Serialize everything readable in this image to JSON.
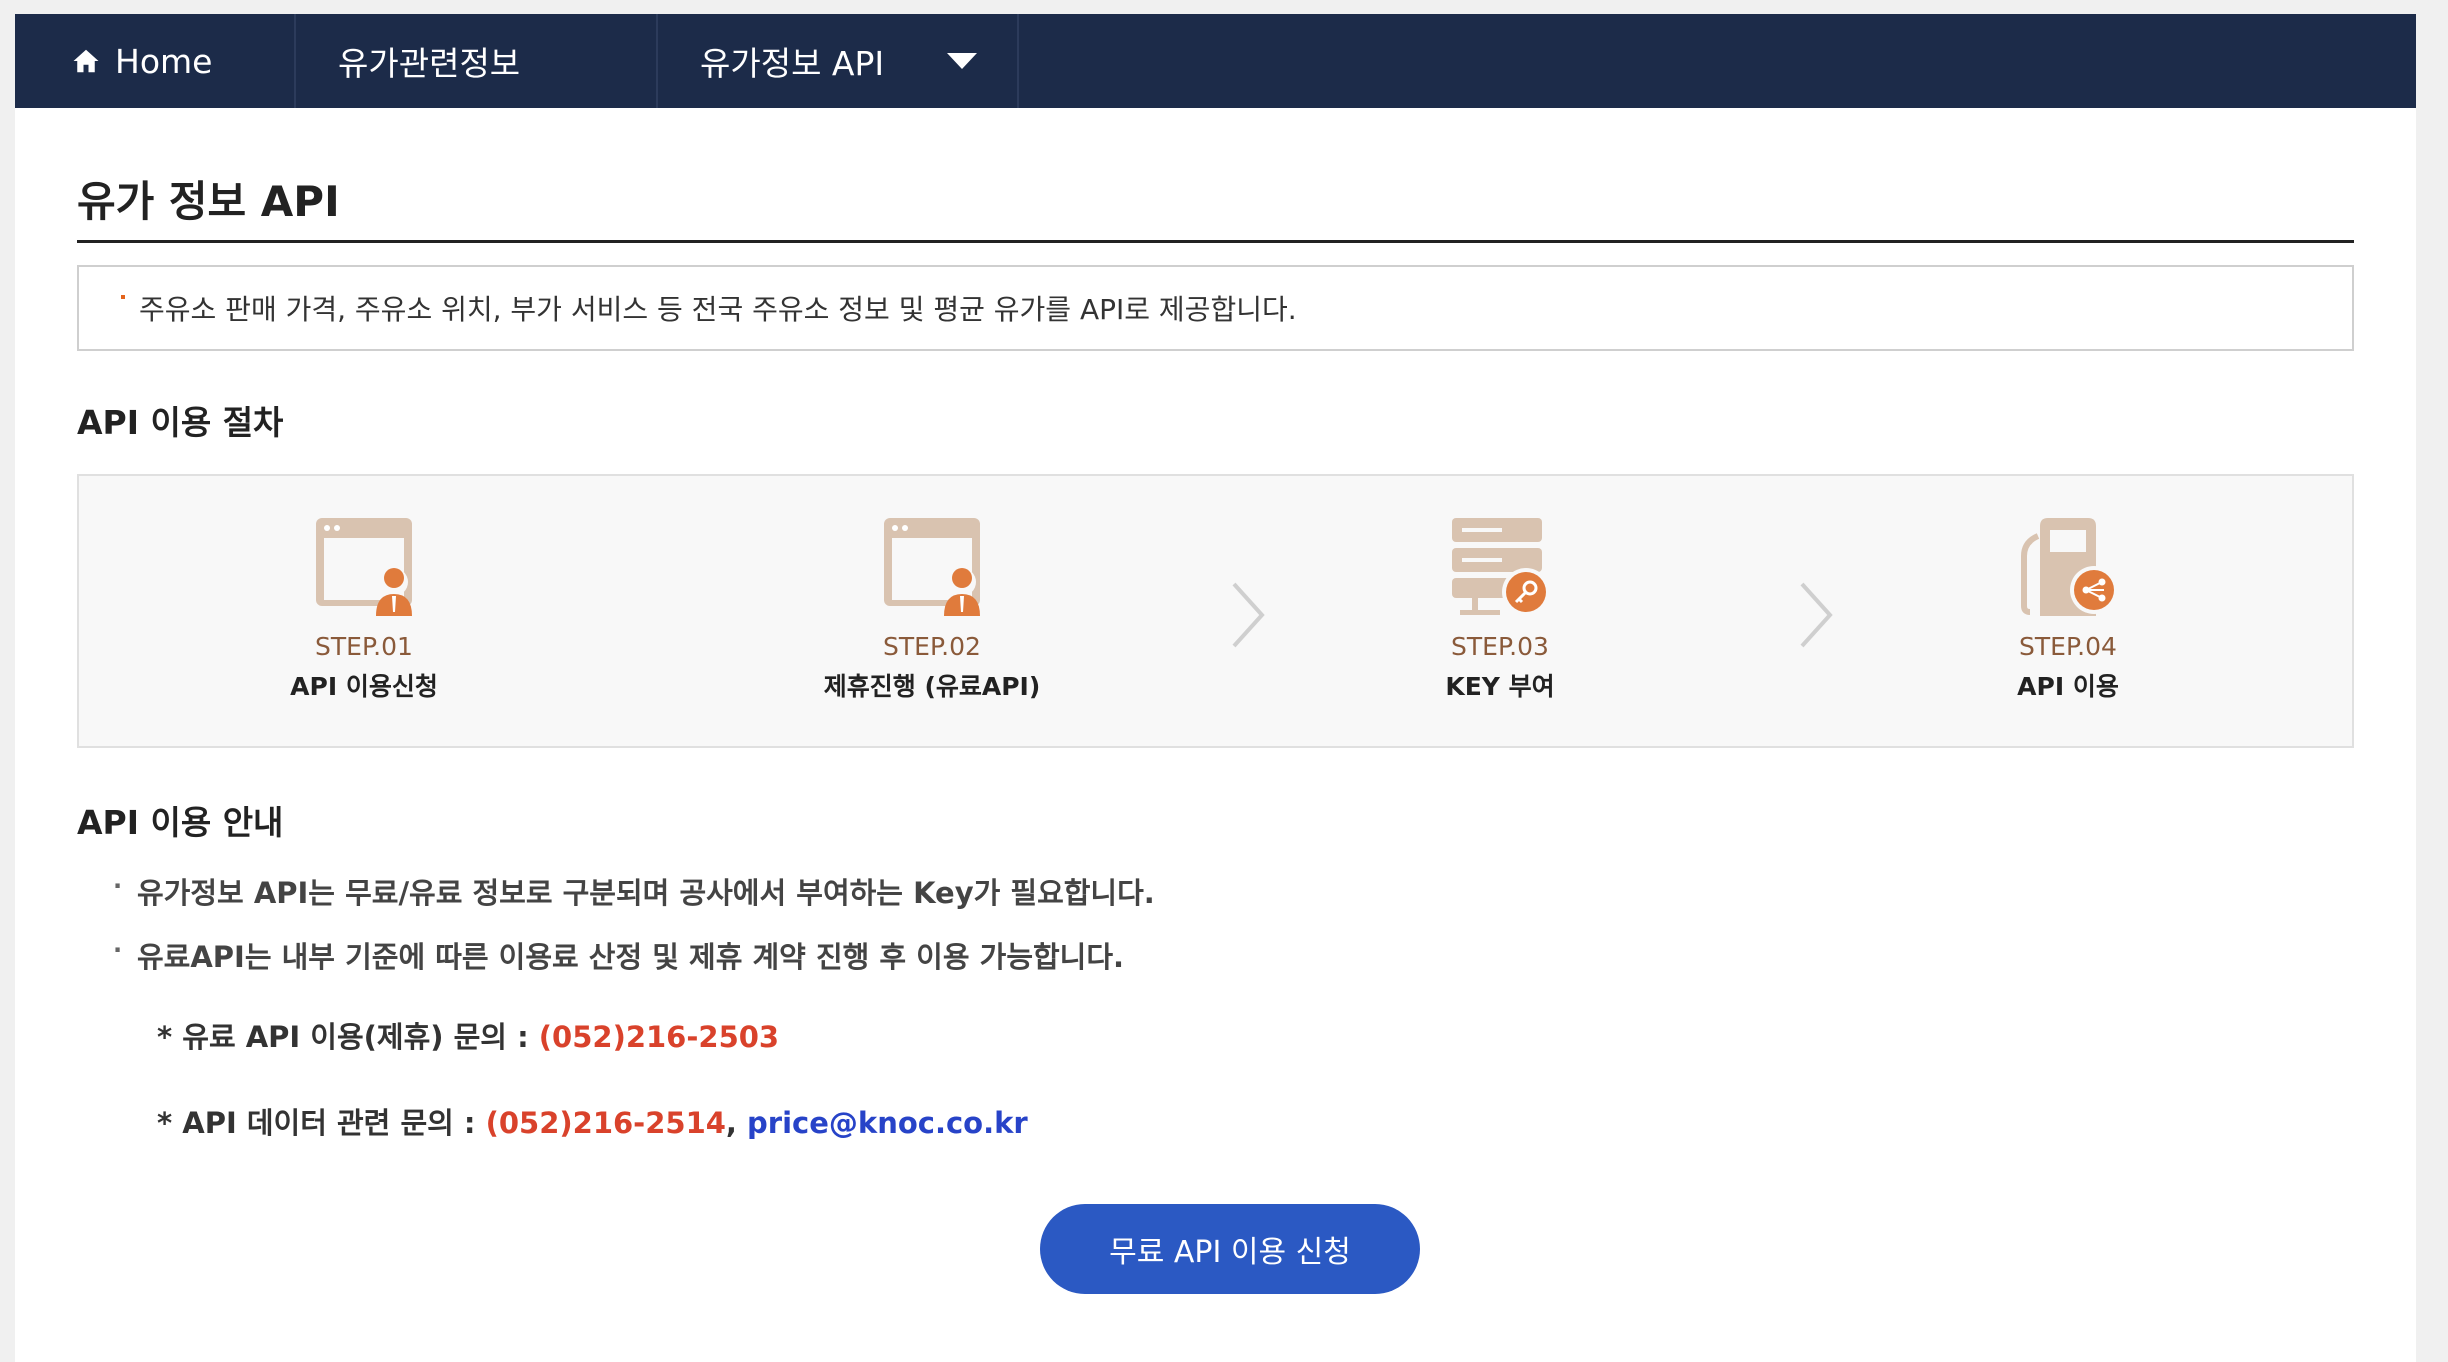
{
  "nav": {
    "home_label": "Home",
    "info_label": "유가관련정보",
    "api_label": "유가정보 API"
  },
  "page": {
    "title": "유가 정보 API",
    "description": "주유소 판매 가격, 주유소 위치, 부가 서비스 등 전국 주유소 정보 및 평균 유가를 API로 제공합니다."
  },
  "procedure": {
    "title": "API 이용 절차",
    "steps": [
      {
        "num": "STEP.01",
        "label": "API 이용신청",
        "icon": "browser-user-icon"
      },
      {
        "num": "STEP.02",
        "label": "제휴진행 (유료API)",
        "icon": "browser-user-icon"
      },
      {
        "num": "STEP.03",
        "label": "KEY 부여",
        "icon": "server-key-icon"
      },
      {
        "num": "STEP.04",
        "label": "API 이용",
        "icon": "fuel-share-icon"
      }
    ]
  },
  "guide": {
    "title": "API 이용 안내",
    "items": [
      "유가정보 API는 무료/유료 정보로 구분되며 공사에서 부여하는 Key가 필요합니다.",
      "유료API는 내부 기준에 따른 이용료 산정 및 제휴 계약 진행 후 이용 가능합니다."
    ],
    "paid_contact_label": "* 유료 API 이용(제휴) 문의 : ",
    "paid_contact_phone": "(052)216-2503",
    "data_contact_label": "* API 데이터 관련 문의 : ",
    "data_contact_phone": "(052)216-2514",
    "data_contact_sep": ", ",
    "data_contact_email": "price@knoc.co.kr"
  },
  "apply_button": "무료 API 이용 신청",
  "colors": {
    "nav_bg": "#1c2b49",
    "icon_tan": "#d9c3b0",
    "icon_orange": "#e07b3c",
    "phone": "#d9422b",
    "email": "#2743c8",
    "button": "#2b59c3"
  }
}
